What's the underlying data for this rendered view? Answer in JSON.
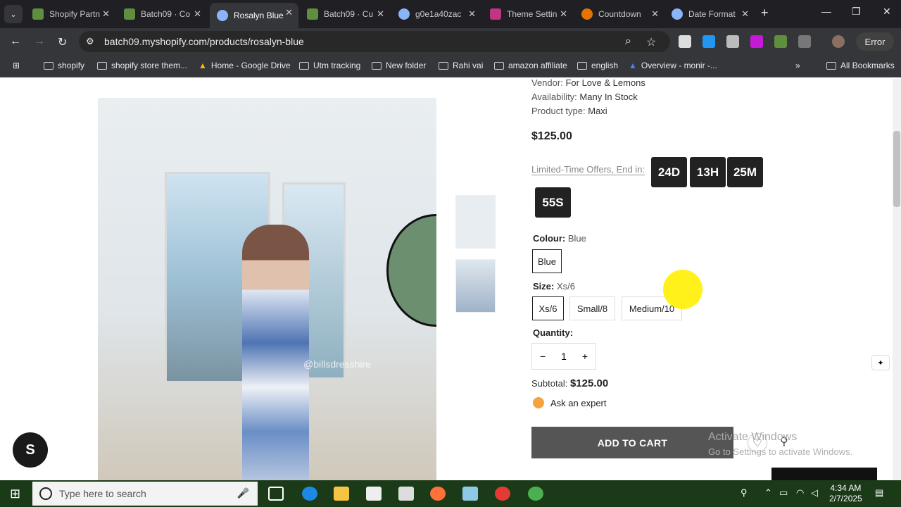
{
  "browser": {
    "tabs": [
      {
        "title": "Shopify Partn",
        "color": "#5e8e3e"
      },
      {
        "title": "Batch09 · Co",
        "color": "#5e8e3e"
      },
      {
        "title": "Rosalyn Blue",
        "color": "#8ab4f8"
      },
      {
        "title": "Batch09 · Cu",
        "color": "#5e8e3e"
      },
      {
        "title": "g0e1a40zac",
        "color": "#8ab4f8"
      },
      {
        "title": "Theme Settin",
        "color": "#c13584"
      },
      {
        "title": "Countdown",
        "color": "#e37400"
      },
      {
        "title": "Date Format",
        "color": "#8ab4f8"
      }
    ],
    "url": "batch09.myshopify.com/products/rosalyn-blue",
    "error_label": "Error",
    "bookmarks": [
      "shopify",
      "shopify store them...",
      "Home - Google Drive",
      "Utm tracking",
      "New folder",
      "Rahi vai",
      "amazon affiliate",
      "english",
      "Overview - monir -..."
    ],
    "all_bookmarks": "All Bookmarks"
  },
  "product": {
    "vendor_label": "Vendor:",
    "vendor": "For Love & Lemons",
    "availability_label": "Availability:",
    "availability": "Many In Stock",
    "type_label": "Product type:",
    "type": "Maxi",
    "price": "$125.00",
    "offer_text": "Limited-Time Offers, End in:",
    "countdown": [
      "24D",
      "13H",
      "25M",
      "55S"
    ],
    "colour_label": "Colour:",
    "colour_value": "Blue",
    "colour_option": "Blue",
    "size_label": "Size:",
    "size_value": "Xs/6",
    "sizes": [
      "Xs/6",
      "Small/8",
      "Medium/10"
    ],
    "quantity_label": "Quantity:",
    "quantity": "1",
    "qty_minus": "−",
    "qty_plus": "+",
    "subtotal_label": "Subtotal:",
    "subtotal": "$125.00",
    "ask_expert": "Ask an expert",
    "add_to_cart": "ADD TO CART",
    "image_watermark": "@billsdresshire"
  },
  "overlay": {
    "activate_title": "Activate Windows",
    "activate_sub": "Go to Settings to activate Windows."
  },
  "taskbar": {
    "search_placeholder": "Type here to search",
    "time": "4:34 AM",
    "date": "2/7/2025"
  }
}
